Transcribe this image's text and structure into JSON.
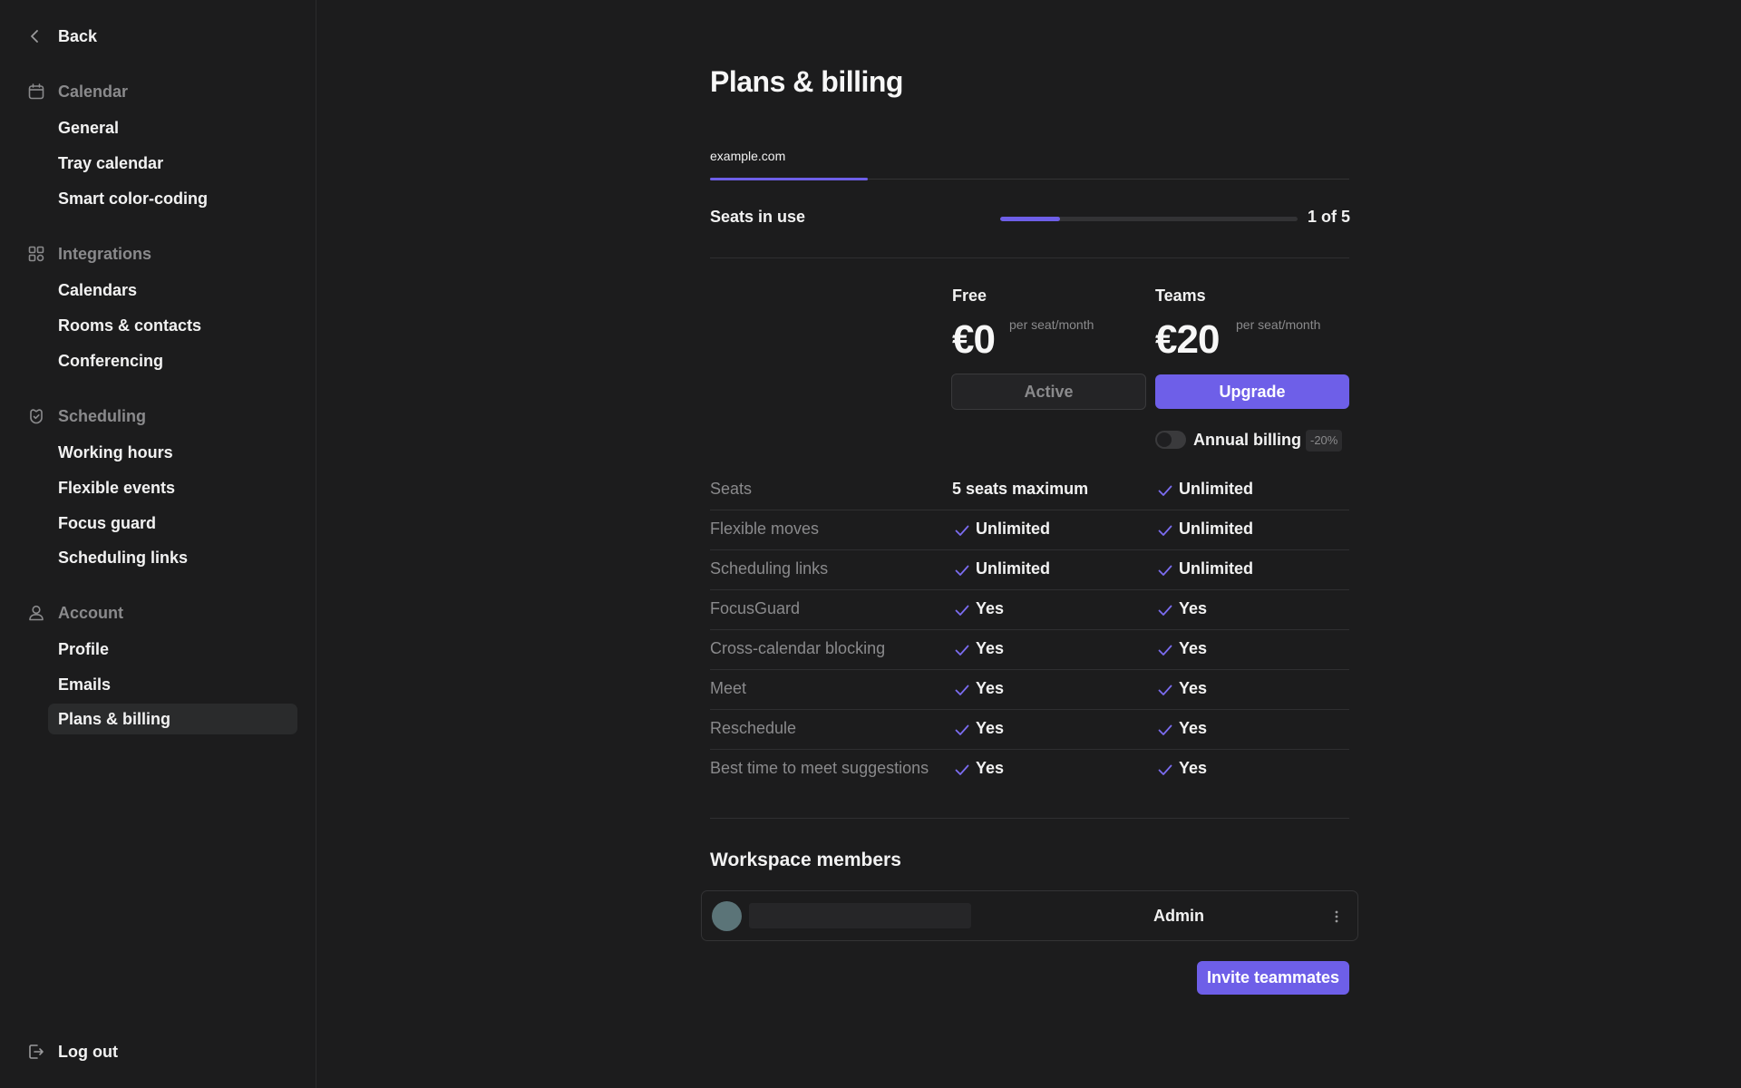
{
  "sidebar": {
    "back_label": "Back",
    "sections": [
      {
        "label": "Calendar",
        "icon": "calendar-icon",
        "items": [
          "General",
          "Tray calendar",
          "Smart color-coding"
        ]
      },
      {
        "label": "Integrations",
        "icon": "integrations-icon",
        "items": [
          "Calendars",
          "Rooms & contacts",
          "Conferencing"
        ]
      },
      {
        "label": "Scheduling",
        "icon": "scheduling-icon",
        "items": [
          "Working hours",
          "Flexible events",
          "Focus guard",
          "Scheduling links"
        ]
      },
      {
        "label": "Account",
        "icon": "user-icon",
        "items": [
          "Profile",
          "Emails",
          "Plans & billing"
        ]
      }
    ],
    "active_item": "Plans & billing",
    "logout_label": "Log out"
  },
  "page": {
    "title": "Plans & billing",
    "tab_label": "example.com"
  },
  "seats": {
    "label": "Seats in use",
    "used": 1,
    "total": 5,
    "count_text": "1 of 5"
  },
  "plans": {
    "free": {
      "name": "Free",
      "price": "€0",
      "per": "per seat/month",
      "button": "Active"
    },
    "teams": {
      "name": "Teams",
      "price": "€20",
      "per": "per seat/month",
      "button": "Upgrade"
    },
    "annual_billing_label": "Annual billing",
    "annual_discount": "-20%",
    "accent_color": "#6e5fe8"
  },
  "features": [
    {
      "name": "Seats",
      "free": "5 seats maximum",
      "free_check": false,
      "teams": "Unlimited",
      "teams_check": true
    },
    {
      "name": "Flexible moves",
      "free": "Unlimited",
      "free_check": true,
      "teams": "Unlimited",
      "teams_check": true
    },
    {
      "name": "Scheduling links",
      "free": "Unlimited",
      "free_check": true,
      "teams": "Unlimited",
      "teams_check": true
    },
    {
      "name": "FocusGuard",
      "free": "Yes",
      "free_check": true,
      "teams": "Yes",
      "teams_check": true
    },
    {
      "name": "Cross-calendar blocking",
      "free": "Yes",
      "free_check": true,
      "teams": "Yes",
      "teams_check": true
    },
    {
      "name": "Meet",
      "free": "Yes",
      "free_check": true,
      "teams": "Yes",
      "teams_check": true
    },
    {
      "name": "Reschedule",
      "free": "Yes",
      "free_check": true,
      "teams": "Yes",
      "teams_check": true
    },
    {
      "name": "Best time to meet suggestions",
      "free": "Yes",
      "free_check": true,
      "teams": "Yes",
      "teams_check": true
    }
  ],
  "members": {
    "title": "Workspace members",
    "rows": [
      {
        "role": "Admin"
      }
    ],
    "invite_label": "Invite teammates"
  }
}
